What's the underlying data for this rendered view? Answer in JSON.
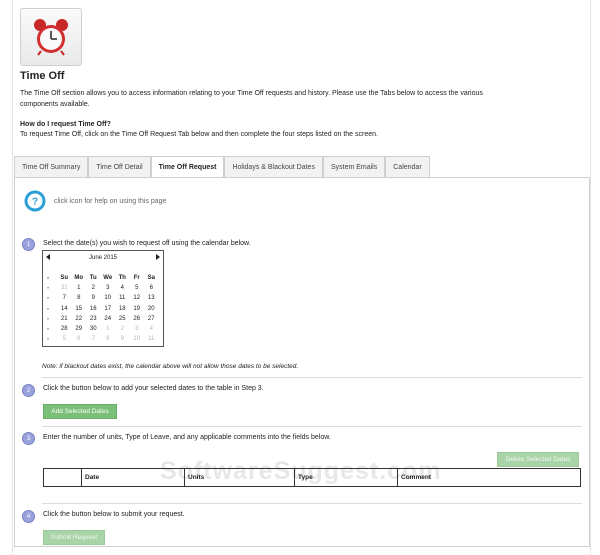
{
  "header": {
    "title": "Time Off",
    "intro": "The Time Off section allows you to access information relating to your Time Off requests and history. Please use the Tabs below to access the various components available.",
    "howto_heading": "How do I request Time Off?",
    "howto_text": "To request Time Off, click on the Time Off Request Tab below and then complete the four steps listed on the screen."
  },
  "tabs": [
    {
      "label": "Time Off Summary",
      "active": false
    },
    {
      "label": "Time Off Detail",
      "active": false
    },
    {
      "label": "Time Off Request",
      "active": true
    },
    {
      "label": "Holidays & Blackout Dates",
      "active": false
    },
    {
      "label": "System Emails",
      "active": false
    },
    {
      "label": "Calendar",
      "active": false
    }
  ],
  "help": {
    "text": "click icon for help on using this page"
  },
  "steps": [
    {
      "number": "1",
      "text": "Select the date(s) you wish to request off using the calendar below."
    },
    {
      "number": "2",
      "text": "Click the button below to add your selected dates to the table in Step 3."
    },
    {
      "number": "3",
      "text": "Enter the number of units, Type of Leave, and any applicable comments into the fields below."
    },
    {
      "number": "4",
      "text": "Click the button below to submit your request."
    }
  ],
  "calendar": {
    "month_label": "June 2015",
    "week_marker": "»",
    "corner_marker": "¤",
    "days_of_week": [
      "Su",
      "Mo",
      "Tu",
      "We",
      "Th",
      "Fr",
      "Sa"
    ],
    "weeks": [
      [
        {
          "d": "31",
          "o": true
        },
        {
          "d": "1",
          "o": false
        },
        {
          "d": "2",
          "o": false
        },
        {
          "d": "3",
          "o": false
        },
        {
          "d": "4",
          "o": false
        },
        {
          "d": "5",
          "o": false
        },
        {
          "d": "6",
          "o": false
        }
      ],
      [
        {
          "d": "7",
          "o": false
        },
        {
          "d": "8",
          "o": false
        },
        {
          "d": "9",
          "o": false
        },
        {
          "d": "10",
          "o": false
        },
        {
          "d": "11",
          "o": false
        },
        {
          "d": "12",
          "o": false
        },
        {
          "d": "13",
          "o": false
        }
      ],
      [
        {
          "d": "14",
          "o": false
        },
        {
          "d": "15",
          "o": false
        },
        {
          "d": "16",
          "o": false
        },
        {
          "d": "17",
          "o": false
        },
        {
          "d": "18",
          "o": false
        },
        {
          "d": "19",
          "o": false
        },
        {
          "d": "20",
          "o": false
        }
      ],
      [
        {
          "d": "21",
          "o": false
        },
        {
          "d": "22",
          "o": false
        },
        {
          "d": "23",
          "o": false
        },
        {
          "d": "24",
          "o": false
        },
        {
          "d": "25",
          "o": false
        },
        {
          "d": "26",
          "o": false
        },
        {
          "d": "27",
          "o": false
        }
      ],
      [
        {
          "d": "28",
          "o": false
        },
        {
          "d": "29",
          "o": false
        },
        {
          "d": "30",
          "o": false
        },
        {
          "d": "1",
          "o": true
        },
        {
          "d": "2",
          "o": true
        },
        {
          "d": "3",
          "o": true
        },
        {
          "d": "4",
          "o": true
        }
      ],
      [
        {
          "d": "5",
          "o": true
        },
        {
          "d": "6",
          "o": true
        },
        {
          "d": "7",
          "o": true
        },
        {
          "d": "8",
          "o": true
        },
        {
          "d": "9",
          "o": true
        },
        {
          "d": "10",
          "o": true
        },
        {
          "d": "11",
          "o": true
        }
      ]
    ]
  },
  "note": "Note: if blackout dates exist, the calendar above will not allow those dates to be selected.",
  "buttons": {
    "add_selected": "Add Selected Dates",
    "delete_selected": "Delete Selected Dates",
    "submit": "Submit Request"
  },
  "table": {
    "columns": [
      "",
      "Date",
      "Units",
      "Type",
      "Comment"
    ]
  },
  "watermark": "SoftwareSuggest.com",
  "colors": {
    "accent_green": "#7bbf79",
    "step_badge": "#9aa2dd",
    "help_blue": "#2a9fd6"
  }
}
